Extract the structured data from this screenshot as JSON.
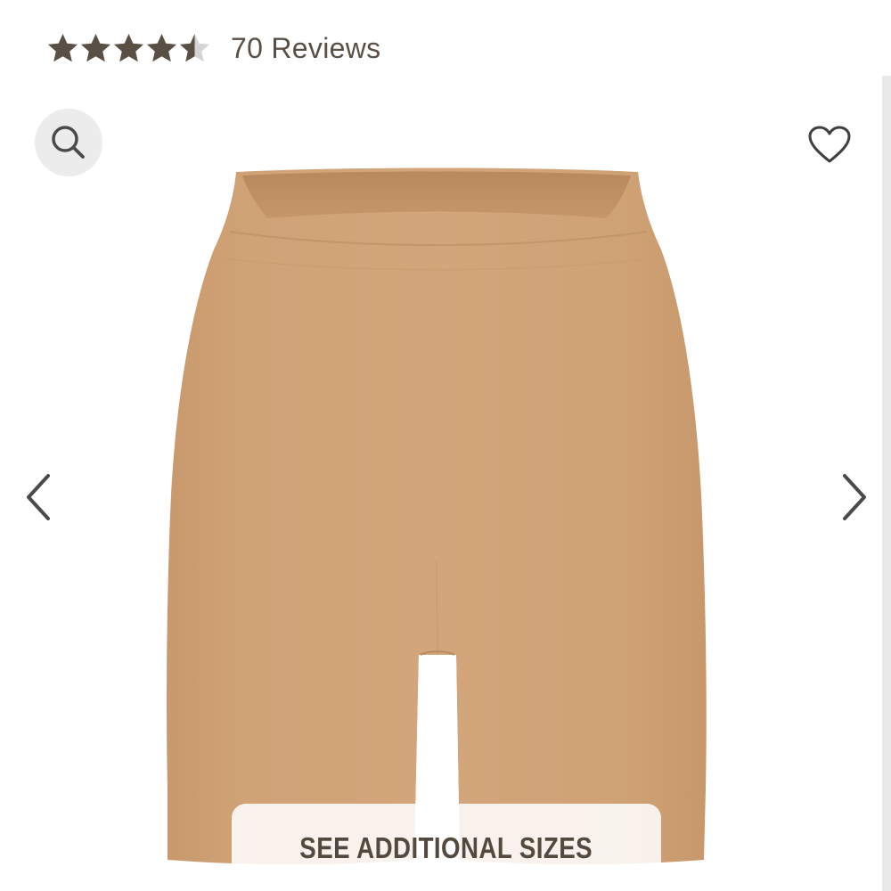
{
  "rating": {
    "value": 4.5,
    "max": 5,
    "reviews_label": "70 Reviews",
    "star_color": "#5a4f45",
    "empty_star_color": "#d4d4d4"
  },
  "gallery": {
    "product_color": "#cfa276",
    "icons": {
      "search": "search-icon",
      "favorite": "heart-icon",
      "previous": "chevron-left-icon",
      "next": "chevron-right-icon"
    },
    "sizes_button_label": "SEE ADDITIONAL SIZES"
  }
}
